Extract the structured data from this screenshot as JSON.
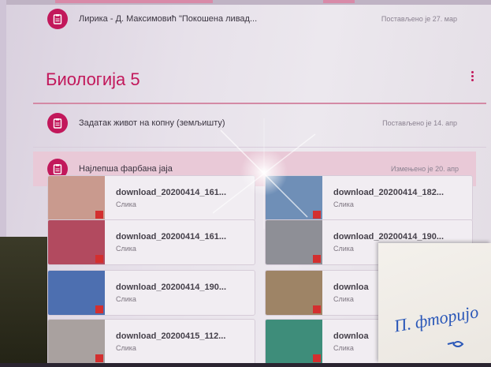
{
  "stream": {
    "items": [
      {
        "title": "Лирика - Д. Максимовић \"Покошена ливад...",
        "date": "Постављено је 27. мар",
        "icon": "assignment-icon"
      },
      {
        "title": "Задатак живот на копну (земљишту)",
        "date": "Постављено је 14. апр",
        "icon": "assignment-icon"
      },
      {
        "title": "Најлепша фарбана јаја",
        "date": "Измењено је 20. апр",
        "icon": "assignment-icon"
      }
    ]
  },
  "topic": {
    "title": "Биологија 5"
  },
  "attachments": [
    {
      "name": "download_20200414_161...",
      "type": "Слика",
      "thumb": "#c99a8e"
    },
    {
      "name": "download_20200414_182...",
      "type": "Слика",
      "thumb": "#6f8fb7"
    },
    {
      "name": "download_20200414_161...",
      "type": "Слика",
      "thumb": "#b24a5f"
    },
    {
      "name": "download_20200414_190...",
      "type": "Слика",
      "thumb": "#8e8f96"
    },
    {
      "name": "download_20200414_190...",
      "type": "Слика",
      "thumb": "#4d6fb0"
    },
    {
      "name": "downloa",
      "type": "Слика",
      "thumb": "#9e8466"
    },
    {
      "name": "download_20200415_112...",
      "type": "Слика",
      "thumb": "#a9a19f"
    },
    {
      "name": "downloa",
      "type": "Слика",
      "thumb": "#3e8d7a"
    }
  ],
  "note": {
    "text": "П. фторијо"
  },
  "colors": {
    "accent": "#c2185b",
    "highlight": "#e9c9d7"
  }
}
